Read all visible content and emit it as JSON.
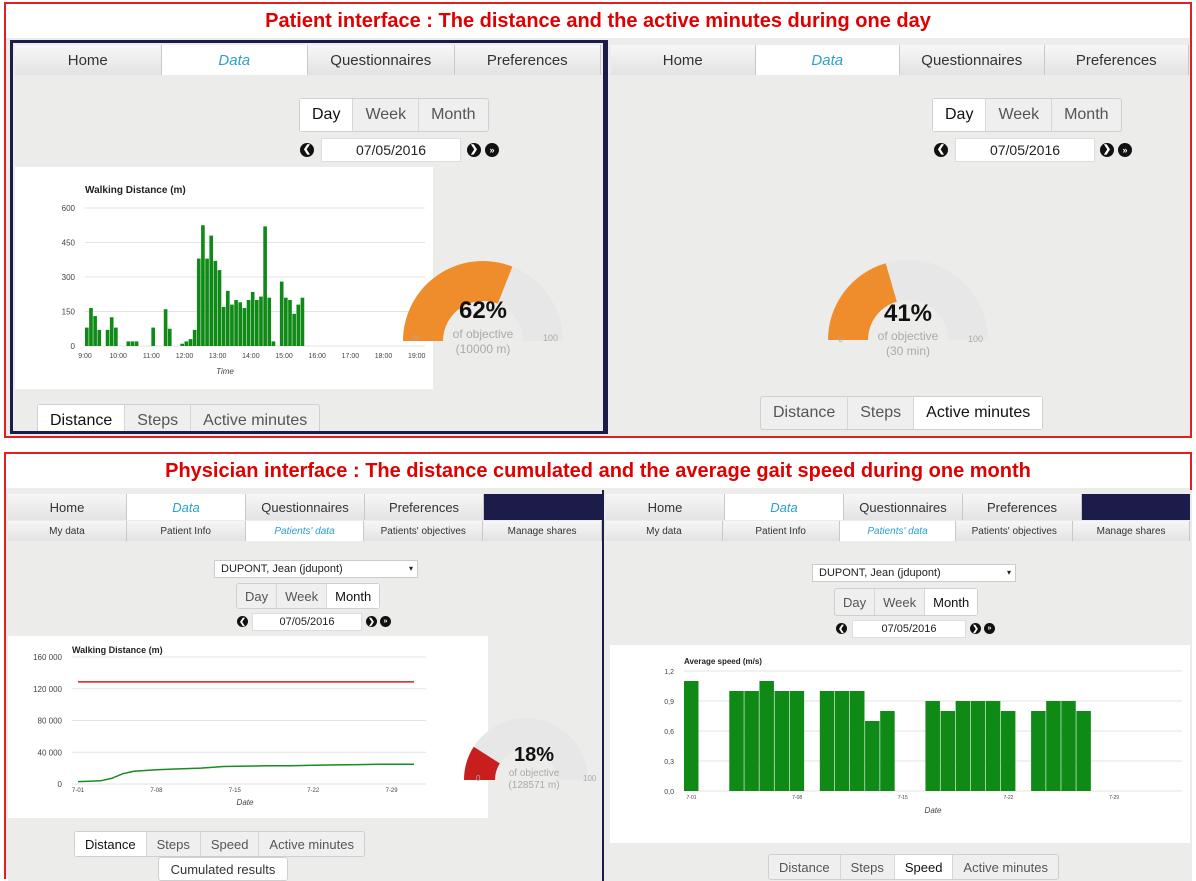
{
  "top_section": {
    "title": "Patient interface : The distance and the active minutes during one day",
    "left": {
      "nav": [
        "Home",
        "Data",
        "Questionnaires",
        "Preferences"
      ],
      "period": [
        "Day",
        "Week",
        "Month"
      ],
      "date": "07/05/2016",
      "gauge": {
        "percent": "62%",
        "sub1": "of objective",
        "sub2": "(10000 m)",
        "min": "0",
        "max": "100",
        "fraction": 0.62
      },
      "metric_tabs": [
        "Distance",
        "Steps",
        "Active minutes"
      ]
    },
    "right": {
      "nav": [
        "Home",
        "Data",
        "Questionnaires",
        "Preferences"
      ],
      "period": [
        "Day",
        "Week",
        "Month"
      ],
      "date": "07/05/2016",
      "gauge": {
        "percent": "41%",
        "sub1": "of objective",
        "sub2": "(30 min)",
        "min": "0",
        "max": "100",
        "fraction": 0.41
      },
      "metric_tabs": [
        "Distance",
        "Steps",
        "Active minutes"
      ]
    }
  },
  "bottom_section": {
    "title": "Physician interface : The distance cumulated and the average gait speed during one month",
    "left": {
      "nav": [
        "Home",
        "Data",
        "Questionnaires",
        "Preferences"
      ],
      "subnav": [
        "My data",
        "Patient Info",
        "Patients' data",
        "Patients' objectives",
        "Manage shares"
      ],
      "patient": "DUPONT, Jean (jdupont)",
      "period": [
        "Day",
        "Week",
        "Month"
      ],
      "date": "07/05/2016",
      "gauge": {
        "percent": "18%",
        "sub1": "of objective",
        "sub2": "(128571 m)",
        "min": "0",
        "max": "100",
        "fraction": 0.18
      },
      "metric_tabs": [
        "Distance",
        "Steps",
        "Speed",
        "Active minutes"
      ],
      "cumulated_label": "Cumulated results"
    },
    "right": {
      "nav": [
        "Home",
        "Data",
        "Questionnaires",
        "Preferences"
      ],
      "subnav": [
        "My data",
        "Patient Info",
        "Patients' data",
        "Patients' objectives",
        "Manage shares"
      ],
      "patient": "DUPONT, Jean (jdupont)",
      "period": [
        "Day",
        "Week",
        "Month"
      ],
      "date": "07/05/2016",
      "metric_tabs": [
        "Distance",
        "Steps",
        "Speed",
        "Active minutes"
      ]
    }
  },
  "colors": {
    "accent_orange": "#ef8d2c",
    "bar_green": "#0f8a17",
    "gauge_red": "#c81e1e",
    "gauge_track": "#e7e7e7",
    "title_red": "#e00000"
  },
  "chart_data": [
    {
      "type": "bar",
      "title": "Walking Distance (m)",
      "xlabel": "Time",
      "ylabel": "",
      "ylim": [
        0,
        600
      ],
      "yticks": [
        "0",
        "150",
        "300",
        "450",
        "600"
      ],
      "xticks": [
        "9:00",
        "10:00",
        "11:00",
        "12:00",
        "13:00",
        "14:00",
        "15:00",
        "16:00",
        "17:00",
        "18:00",
        "19:00"
      ],
      "x_start_hour": 9,
      "x_end_hour": 19.25,
      "bar_width_hours": 0.125,
      "bar_starts_hours": [
        9,
        9.125,
        9.25,
        9.375,
        9.625,
        9.75,
        9.875,
        10.25,
        10.375,
        10.5,
        11,
        11.375,
        11.5,
        11.875,
        12,
        12.125,
        12.25,
        12.375,
        12.5,
        12.625,
        12.75,
        12.875,
        13,
        13.125,
        13.25,
        13.375,
        13.5,
        13.625,
        13.75,
        13.875,
        14,
        14.125,
        14.25,
        14.375,
        14.5,
        14.625,
        14.875,
        15,
        15.125,
        15.25,
        15.375,
        15.5,
        15.75,
        15.875,
        16
      ],
      "values": [
        80,
        165,
        130,
        70,
        70,
        125,
        80,
        20,
        20,
        20,
        80,
        160,
        75,
        10,
        20,
        30,
        70,
        380,
        525,
        380,
        480,
        370,
        330,
        170,
        240,
        180,
        200,
        190,
        165,
        200,
        235,
        200,
        215,
        520,
        210,
        20,
        280,
        210,
        200,
        140,
        180,
        210,
        0,
        0,
        0
      ]
    },
    {
      "type": "line",
      "title": "Walking Distance (m)",
      "xlabel": "Date",
      "ylabel": "",
      "ylim": [
        0,
        160000
      ],
      "yticks": [
        "0",
        "40 000",
        "80 000",
        "120 000",
        "160 000"
      ],
      "xticks": [
        "7-01",
        "7-08",
        "7-15",
        "7-22",
        "7-29"
      ],
      "x_days": [
        1,
        31
      ],
      "series": [
        {
          "color": "#d42020",
          "x": [
            1,
            31
          ],
          "values": [
            128571,
            128571
          ]
        },
        {
          "color": "#1a8a22",
          "x": [
            1,
            2,
            3,
            4,
            5,
            6,
            8,
            10,
            12,
            14,
            16,
            18,
            20,
            22,
            24,
            26,
            28,
            30,
            31
          ],
          "values": [
            3000,
            3500,
            4000,
            7000,
            13000,
            16000,
            18000,
            19000,
            20000,
            22000,
            22500,
            23000,
            23000,
            23500,
            24000,
            24500,
            25000,
            25000,
            25000
          ]
        }
      ]
    },
    {
      "type": "bar",
      "title": "Average speed (m/s)",
      "xlabel": "Date",
      "ylabel": "",
      "ylim": [
        0,
        1.2
      ],
      "yticks": [
        "0,0",
        "0,3",
        "0,6",
        "0,9",
        "1,2"
      ],
      "xticks": [
        "7-01",
        "7-08",
        "7-15",
        "7-22",
        "7-29"
      ],
      "x_days": [
        1,
        31
      ],
      "categories": [
        "7-01",
        "7-02",
        "7-03",
        "7-04",
        "7-05",
        "7-06",
        "7-07",
        "7-08",
        "7-09",
        "7-10",
        "7-11",
        "7-12",
        "7-13",
        "7-14",
        "7-15",
        "7-16",
        "7-17",
        "7-18",
        "7-19",
        "7-20",
        "7-21",
        "7-22",
        "7-23",
        "7-24",
        "7-25",
        "7-26",
        "7-27",
        "7-28",
        "7-29",
        "7-30",
        "7-31"
      ],
      "values": [
        1.1,
        0,
        0,
        1.0,
        1.0,
        1.1,
        1.0,
        1.0,
        0,
        1.0,
        1.0,
        1.0,
        0.7,
        0.8,
        0,
        0,
        0.9,
        0.8,
        0.9,
        0.9,
        0.9,
        0.8,
        0,
        0.8,
        0.9,
        0.9,
        0.8,
        0,
        0,
        0,
        0
      ]
    }
  ]
}
